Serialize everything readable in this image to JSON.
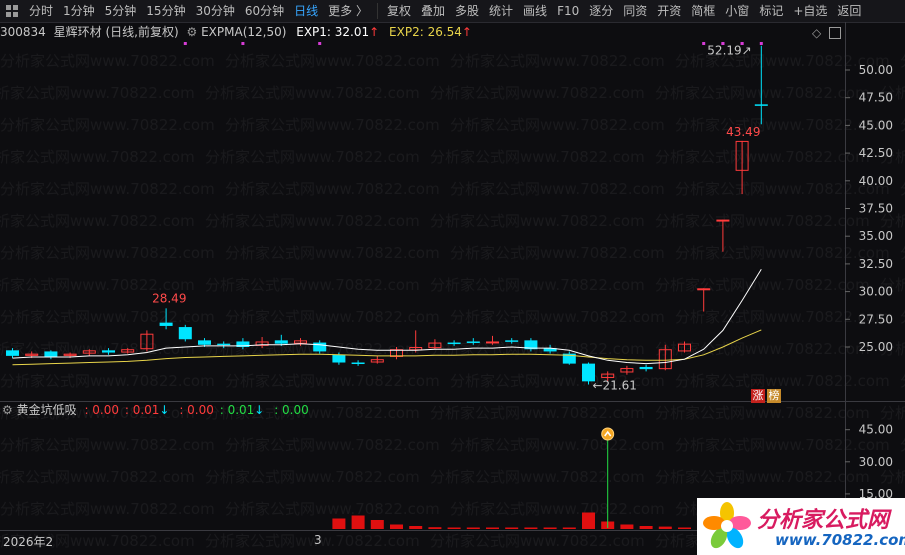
{
  "toolbar": {
    "periods": [
      "分时",
      "1分钟",
      "5分钟",
      "15分钟",
      "30分钟",
      "60分钟",
      "日线",
      "更多 〉"
    ],
    "active_index": 6,
    "actions": [
      "复权",
      "叠加",
      "多股",
      "统计",
      "画线",
      "F10",
      "逐分",
      "同资",
      "开资",
      "简框",
      "小窗",
      "标记",
      "+自选",
      "返回"
    ]
  },
  "stock": {
    "code": "300834",
    "name": "星辉环材",
    "mode": "(日线,前复权)"
  },
  "indicator": {
    "name": "EXPMA(12,50)",
    "exp1_label": "EXP1: 32.01",
    "exp2_label": "EXP2: 26.54",
    "arrow": "↑"
  },
  "sub_indicator": {
    "name": "黄金坑低吸",
    "values": [
      ": 0.00",
      ": 0.01",
      ": 0.00",
      ": 0.01",
      ": 0.00"
    ],
    "arrows": [
      "↓",
      "↓"
    ]
  },
  "price_axis": [
    "50.00",
    "47.50",
    "45.00",
    "42.50",
    "40.00",
    "37.50",
    "35.00",
    "32.50",
    "30.00",
    "27.50",
    "25.00"
  ],
  "sub_axis": [
    "45.00",
    "30.00",
    "15.00"
  ],
  "annotations": {
    "high_1": "28.49",
    "low_1": "21.61",
    "high_2": "43.49",
    "high_top": "52.19"
  },
  "badges": [
    "涨",
    "榜"
  ],
  "date_axis": [
    "2026年2",
    "3"
  ],
  "watermark_text": "分析家公式网www.70822.com",
  "logo": {
    "title": "分析家公式网",
    "url": "www.70822.com"
  },
  "colors": {
    "up": "#ff3b3b",
    "down": "#00e5ff",
    "exp1": "#ffffff",
    "exp2": "#e8d44a",
    "active": "#37a6ff"
  },
  "chart_data": {
    "type": "candlestick",
    "ylim": [
      21,
      53
    ],
    "candles": [
      {
        "o": 24.7,
        "c": 24.2,
        "h": 24.9,
        "l": 24.0
      },
      {
        "o": 24.2,
        "c": 24.4,
        "h": 24.6,
        "l": 24.0
      },
      {
        "o": 24.6,
        "c": 24.1,
        "h": 24.7,
        "l": 23.9
      },
      {
        "o": 24.2,
        "c": 24.4,
        "h": 24.5,
        "l": 24.0
      },
      {
        "o": 24.4,
        "c": 24.7,
        "h": 24.8,
        "l": 24.2
      },
      {
        "o": 24.7,
        "c": 24.5,
        "h": 24.9,
        "l": 24.3
      },
      {
        "o": 24.5,
        "c": 24.8,
        "h": 24.9,
        "l": 24.4
      },
      {
        "o": 24.8,
        "c": 26.2,
        "h": 26.5,
        "l": 24.6
      },
      {
        "o": 27.2,
        "c": 26.9,
        "h": 28.49,
        "l": 26.6
      },
      {
        "o": 26.8,
        "c": 25.7,
        "h": 27.0,
        "l": 25.5
      },
      {
        "o": 25.6,
        "c": 25.2,
        "h": 25.8,
        "l": 25.0
      },
      {
        "o": 25.3,
        "c": 25.2,
        "h": 25.5,
        "l": 24.9
      },
      {
        "o": 25.5,
        "c": 25.0,
        "h": 25.8,
        "l": 24.8
      },
      {
        "o": 25.1,
        "c": 25.5,
        "h": 25.9,
        "l": 24.9
      },
      {
        "o": 25.6,
        "c": 25.3,
        "h": 26.1,
        "l": 25.1
      },
      {
        "o": 25.3,
        "c": 25.6,
        "h": 25.8,
        "l": 25.1
      },
      {
        "o": 25.4,
        "c": 24.6,
        "h": 25.6,
        "l": 24.4
      },
      {
        "o": 24.3,
        "c": 23.6,
        "h": 24.5,
        "l": 23.4
      },
      {
        "o": 23.6,
        "c": 23.5,
        "h": 23.8,
        "l": 23.3
      },
      {
        "o": 23.6,
        "c": 23.9,
        "h": 24.2,
        "l": 23.5
      },
      {
        "o": 24.1,
        "c": 24.8,
        "h": 25.0,
        "l": 23.9
      },
      {
        "o": 24.7,
        "c": 25.0,
        "h": 26.5,
        "l": 24.5
      },
      {
        "o": 24.9,
        "c": 25.4,
        "h": 25.7,
        "l": 24.8
      },
      {
        "o": 25.4,
        "c": 25.3,
        "h": 25.6,
        "l": 25.1
      },
      {
        "o": 25.5,
        "c": 25.4,
        "h": 25.8,
        "l": 25.2
      },
      {
        "o": 25.4,
        "c": 25.5,
        "h": 26.0,
        "l": 25.2
      },
      {
        "o": 25.6,
        "c": 25.5,
        "h": 25.8,
        "l": 25.3
      },
      {
        "o": 25.6,
        "c": 24.8,
        "h": 25.8,
        "l": 24.6
      },
      {
        "o": 24.9,
        "c": 24.6,
        "h": 25.2,
        "l": 24.4
      },
      {
        "o": 24.4,
        "c": 23.5,
        "h": 24.6,
        "l": 23.4
      },
      {
        "o": 23.5,
        "c": 21.9,
        "h": 23.6,
        "l": 21.61
      },
      {
        "o": 22.2,
        "c": 22.6,
        "h": 22.8,
        "l": 21.9
      },
      {
        "o": 22.7,
        "c": 23.1,
        "h": 23.3,
        "l": 22.5
      },
      {
        "o": 23.2,
        "c": 23.0,
        "h": 23.4,
        "l": 22.8
      },
      {
        "o": 23.0,
        "c": 24.8,
        "h": 25.2,
        "l": 22.9
      },
      {
        "o": 24.6,
        "c": 25.3,
        "h": 25.5,
        "l": 24.5
      },
      {
        "o": 30.2,
        "c": 30.3,
        "h": 30.3,
        "l": 28.2
      },
      {
        "o": 36.4,
        "c": 36.5,
        "h": 36.5,
        "l": 33.6
      },
      {
        "o": 40.9,
        "c": 43.6,
        "h": 43.6,
        "l": 38.8
      },
      {
        "o": 46.9,
        "c": 46.8,
        "h": 52.19,
        "l": 45.1
      }
    ],
    "exp1": [
      24.0,
      24.1,
      24.1,
      24.1,
      24.2,
      24.2,
      24.3,
      24.5,
      24.9,
      25.0,
      25.1,
      25.1,
      25.1,
      25.2,
      25.2,
      25.3,
      25.2,
      25.0,
      24.8,
      24.7,
      24.7,
      24.7,
      24.8,
      24.8,
      24.9,
      24.9,
      25.0,
      24.9,
      24.9,
      24.7,
      24.2,
      23.8,
      23.6,
      23.5,
      23.6,
      23.9,
      24.8,
      26.5,
      29.2,
      32.01
    ],
    "exp2": [
      23.4,
      23.45,
      23.5,
      23.55,
      23.6,
      23.65,
      23.7,
      23.8,
      23.95,
      24.05,
      24.1,
      24.15,
      24.2,
      24.25,
      24.3,
      24.35,
      24.35,
      24.3,
      24.25,
      24.2,
      24.2,
      24.2,
      24.25,
      24.25,
      24.3,
      24.3,
      24.35,
      24.35,
      24.3,
      24.25,
      24.1,
      23.95,
      23.85,
      23.8,
      23.8,
      23.9,
      24.3,
      25.0,
      25.8,
      26.54
    ],
    "volume": [
      0,
      0,
      0,
      0,
      0,
      0,
      0,
      0,
      0,
      0,
      0,
      0,
      0,
      0,
      0,
      0,
      0,
      3.5,
      4.5,
      3.0,
      1.5,
      1.0,
      0.6,
      0.5,
      0.5,
      0.5,
      0.5,
      0.5,
      0.5,
      0.5,
      5.5,
      2.5,
      1.5,
      1.0,
      0.8,
      0.5,
      0,
      0,
      0,
      0
    ],
    "signal_index": 31,
    "sub_ylim": [
      0,
      50
    ]
  }
}
